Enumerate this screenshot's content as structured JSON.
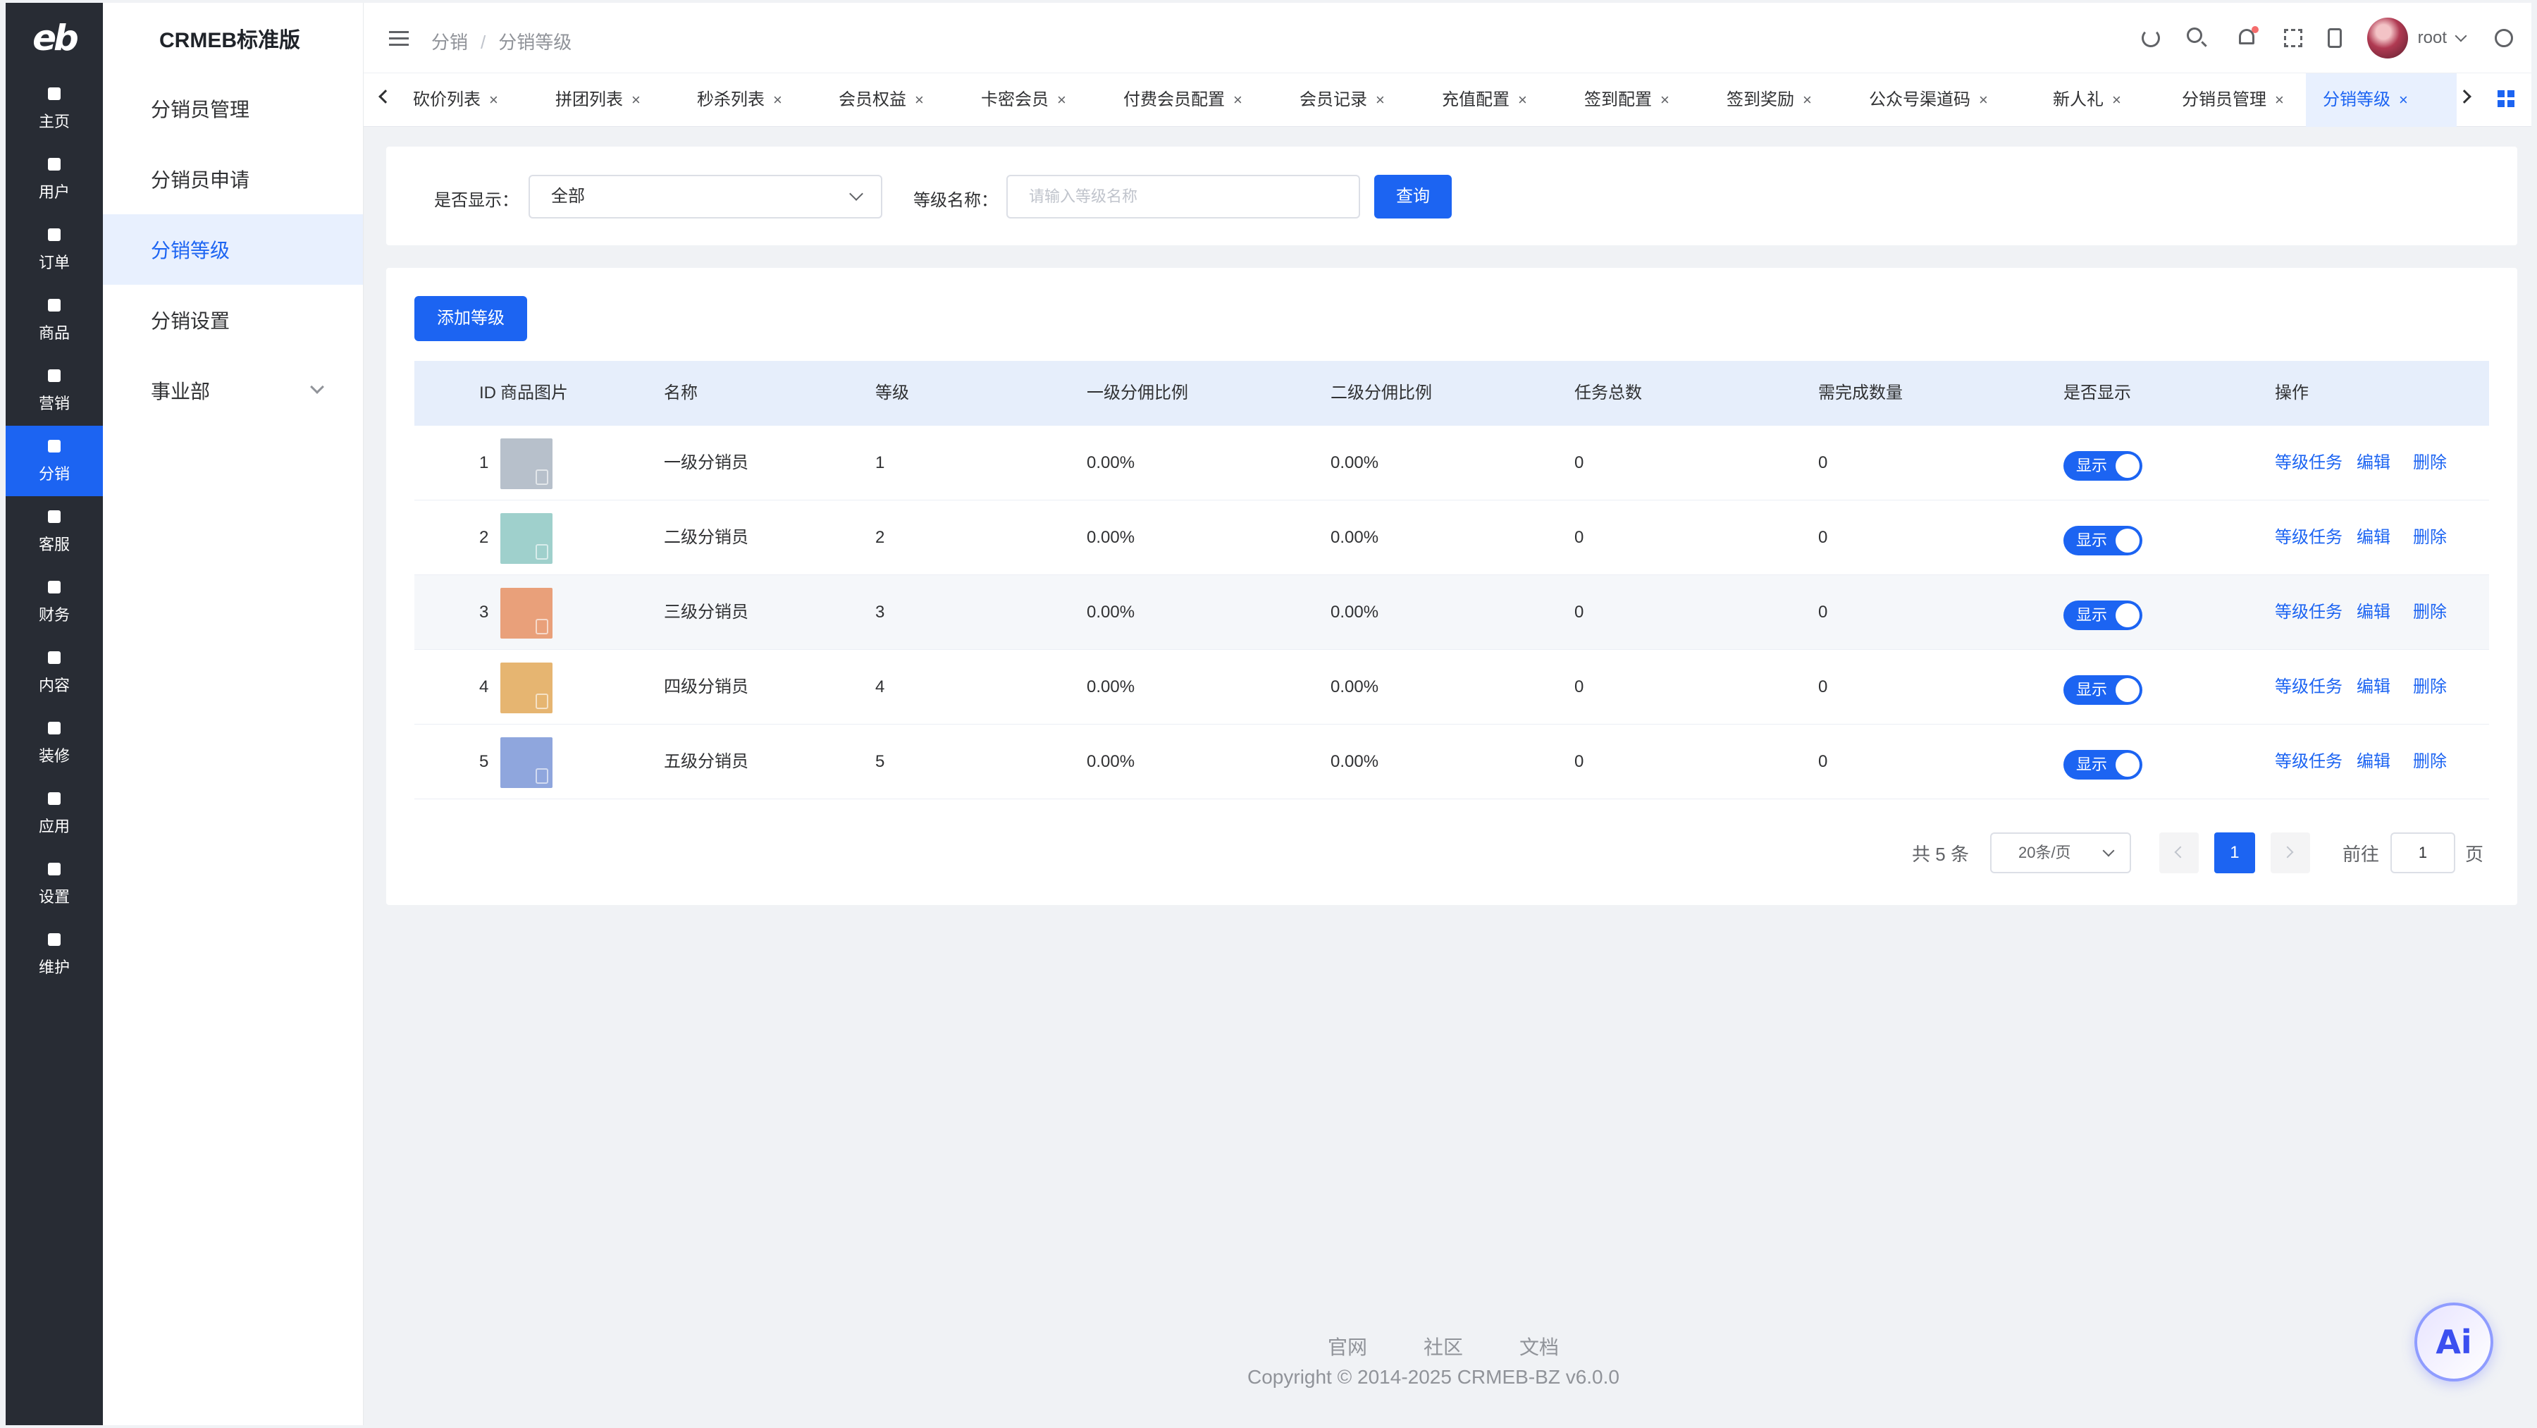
{
  "rail": {
    "logo": "eb",
    "items": [
      {
        "label": "主页",
        "icon": "home-icon"
      },
      {
        "label": "用户",
        "icon": "user-icon"
      },
      {
        "label": "订单",
        "icon": "order-icon"
      },
      {
        "label": "商品",
        "icon": "product-icon"
      },
      {
        "label": "营销",
        "icon": "marketing-icon"
      },
      {
        "label": "分销",
        "icon": "send-icon"
      },
      {
        "label": "客服",
        "icon": "bell-icon"
      },
      {
        "label": "财务",
        "icon": "wallet-icon"
      },
      {
        "label": "内容",
        "icon": "book-icon"
      },
      {
        "label": "装修",
        "icon": "brush-icon"
      },
      {
        "label": "应用",
        "icon": "apps-icon"
      },
      {
        "label": "设置",
        "icon": "gear-icon"
      },
      {
        "label": "维护",
        "icon": "maintenance-icon"
      }
    ],
    "active_index": 5
  },
  "submenu": {
    "brand": "CRMEB标准版",
    "items": [
      "分销员管理",
      "分销员申请",
      "分销等级",
      "分销设置",
      "事业部"
    ],
    "active_index": 2
  },
  "header": {
    "breadcrumb": [
      "分销",
      "分销等级"
    ],
    "username": "root"
  },
  "tags": [
    {
      "label": "砍价列表"
    },
    {
      "label": "拼团列表"
    },
    {
      "label": "秒杀列表"
    },
    {
      "label": "会员权益"
    },
    {
      "label": "卡密会员"
    },
    {
      "label": "付费会员配置"
    },
    {
      "label": "会员记录"
    },
    {
      "label": "充值配置"
    },
    {
      "label": "签到配置"
    },
    {
      "label": "签到奖励"
    },
    {
      "label": "公众号渠道码"
    },
    {
      "label": "新人礼"
    },
    {
      "label": "分销员管理"
    },
    {
      "label": "分销等级"
    }
  ],
  "tag_close": "×",
  "filter": {
    "show_label": "是否显示：",
    "show_value": "全部",
    "name_label": "等级名称：",
    "name_placeholder": "请输入等级名称",
    "query_button": "查询"
  },
  "table": {
    "add_button": "添加等级",
    "columns": [
      "ID",
      "商品图片",
      "名称",
      "等级",
      "一级分佣比例",
      "二级分佣比例",
      "任务总数",
      "需完成数量",
      "是否显示",
      "操作"
    ],
    "rows": [
      {
        "id": "1",
        "name": "一级分销员",
        "level": "1",
        "rate1": "0.00%",
        "rate2": "0.00%",
        "tasks": "0",
        "need": "0",
        "show": "显示",
        "color": "#b7c0cb"
      },
      {
        "id": "2",
        "name": "二级分销员",
        "level": "2",
        "rate1": "0.00%",
        "rate2": "0.00%",
        "tasks": "0",
        "need": "0",
        "show": "显示",
        "color": "#9fd0cc"
      },
      {
        "id": "3",
        "name": "三级分销员",
        "level": "3",
        "rate1": "0.00%",
        "rate2": "0.00%",
        "tasks": "0",
        "need": "0",
        "show": "显示",
        "color": "#e9a07a"
      },
      {
        "id": "4",
        "name": "四级分销员",
        "level": "4",
        "rate1": "0.00%",
        "rate2": "0.00%",
        "tasks": "0",
        "need": "0",
        "show": "显示",
        "color": "#e6b571"
      },
      {
        "id": "5",
        "name": "五级分销员",
        "level": "5",
        "rate1": "0.00%",
        "rate2": "0.00%",
        "tasks": "0",
        "need": "0",
        "show": "显示",
        "color": "#8fa6dd"
      }
    ],
    "ops": [
      "等级任务",
      "编辑",
      "删除"
    ]
  },
  "pagination": {
    "total": "共 5 条",
    "page_size": "20条/页",
    "current": "1",
    "goto_label": "前往",
    "goto_value": "1",
    "page_suffix": "页"
  },
  "footer": {
    "links": [
      "官网",
      "社区",
      "文档"
    ],
    "copyright": "Copyright © 2014-2025 CRMEB-BZ v6.0.0"
  },
  "ai_badge": "Ai",
  "colors": {
    "primary": "#1c64f2",
    "rail_bg": "#282c34",
    "page_bg": "#f0f2f5"
  }
}
